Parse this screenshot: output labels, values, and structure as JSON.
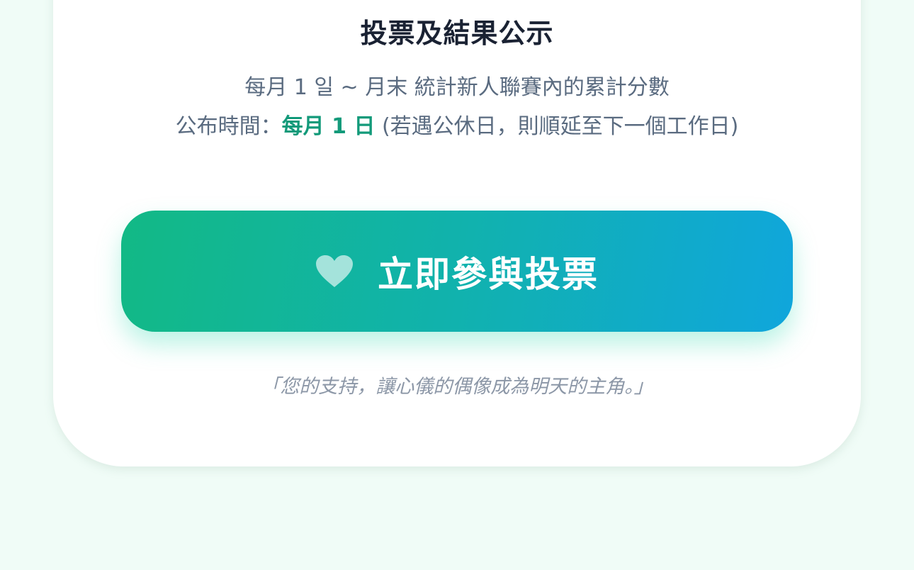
{
  "section": {
    "title": "投票及結果公示",
    "period_text": "每月 1 일 ~ 月末 統計新人聯賽內的累計分數",
    "announce_prefix": "公布時間：",
    "announce_date": "每月 1 日",
    "announce_suffix": " (若遇公休日，則順延至下一個工作日)"
  },
  "vote_button": {
    "label": "立即參與投票",
    "icon": "heart-icon"
  },
  "quote": "「您的支持，讓心儀的偶像成為明天的主角。」",
  "colors": {
    "page_background": "#f0fcf7",
    "gradient_start": "#12b985",
    "gradient_end": "#10a6dc",
    "highlight": "#139a7a",
    "title": "#1a2233",
    "body_text": "#5a6b80",
    "quote_text": "#8c97a7"
  }
}
